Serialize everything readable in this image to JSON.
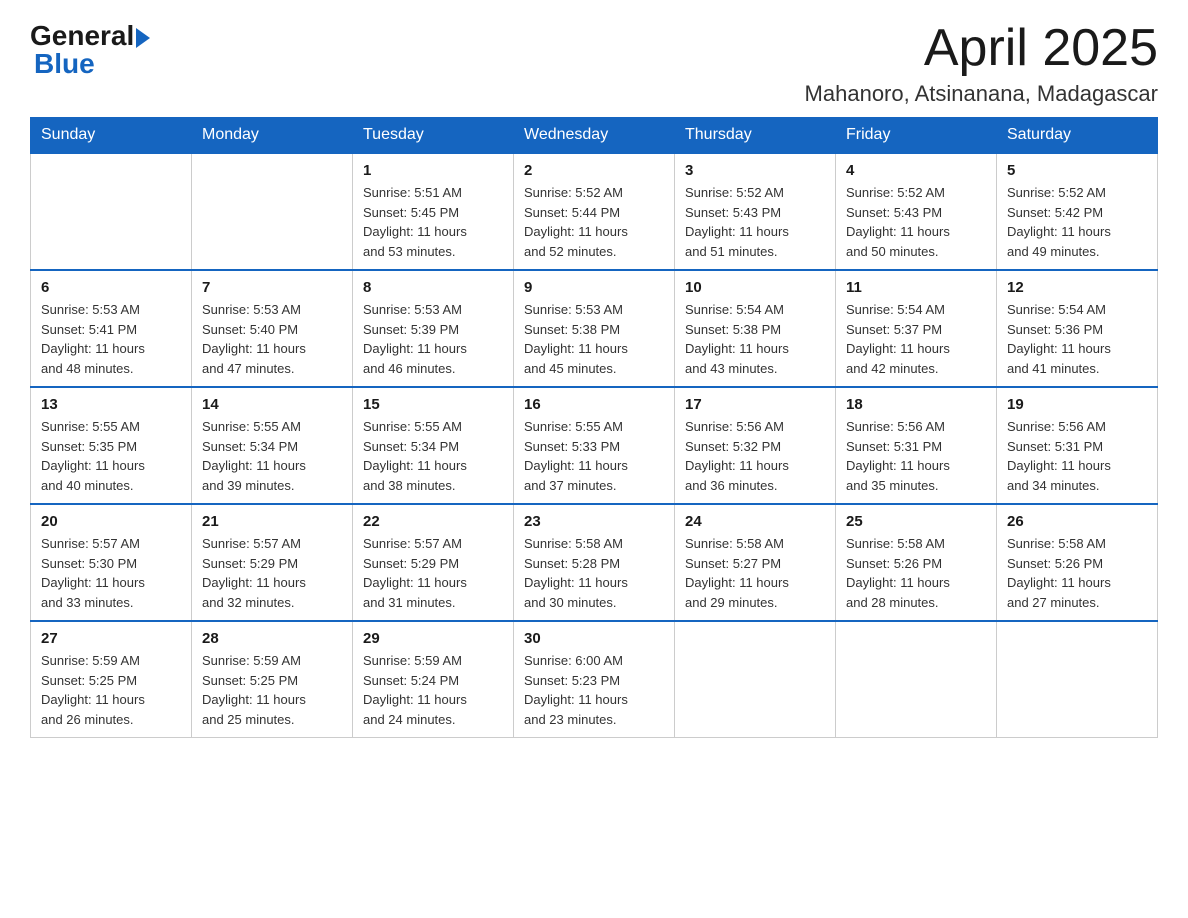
{
  "logo": {
    "general": "General",
    "blue": "Blue"
  },
  "title": "April 2025",
  "location": "Mahanoro, Atsinanana, Madagascar",
  "days_of_week": [
    "Sunday",
    "Monday",
    "Tuesday",
    "Wednesday",
    "Thursday",
    "Friday",
    "Saturday"
  ],
  "weeks": [
    [
      {
        "day": "",
        "info": ""
      },
      {
        "day": "",
        "info": ""
      },
      {
        "day": "1",
        "info": "Sunrise: 5:51 AM\nSunset: 5:45 PM\nDaylight: 11 hours\nand 53 minutes."
      },
      {
        "day": "2",
        "info": "Sunrise: 5:52 AM\nSunset: 5:44 PM\nDaylight: 11 hours\nand 52 minutes."
      },
      {
        "day": "3",
        "info": "Sunrise: 5:52 AM\nSunset: 5:43 PM\nDaylight: 11 hours\nand 51 minutes."
      },
      {
        "day": "4",
        "info": "Sunrise: 5:52 AM\nSunset: 5:43 PM\nDaylight: 11 hours\nand 50 minutes."
      },
      {
        "day": "5",
        "info": "Sunrise: 5:52 AM\nSunset: 5:42 PM\nDaylight: 11 hours\nand 49 minutes."
      }
    ],
    [
      {
        "day": "6",
        "info": "Sunrise: 5:53 AM\nSunset: 5:41 PM\nDaylight: 11 hours\nand 48 minutes."
      },
      {
        "day": "7",
        "info": "Sunrise: 5:53 AM\nSunset: 5:40 PM\nDaylight: 11 hours\nand 47 minutes."
      },
      {
        "day": "8",
        "info": "Sunrise: 5:53 AM\nSunset: 5:39 PM\nDaylight: 11 hours\nand 46 minutes."
      },
      {
        "day": "9",
        "info": "Sunrise: 5:53 AM\nSunset: 5:38 PM\nDaylight: 11 hours\nand 45 minutes."
      },
      {
        "day": "10",
        "info": "Sunrise: 5:54 AM\nSunset: 5:38 PM\nDaylight: 11 hours\nand 43 minutes."
      },
      {
        "day": "11",
        "info": "Sunrise: 5:54 AM\nSunset: 5:37 PM\nDaylight: 11 hours\nand 42 minutes."
      },
      {
        "day": "12",
        "info": "Sunrise: 5:54 AM\nSunset: 5:36 PM\nDaylight: 11 hours\nand 41 minutes."
      }
    ],
    [
      {
        "day": "13",
        "info": "Sunrise: 5:55 AM\nSunset: 5:35 PM\nDaylight: 11 hours\nand 40 minutes."
      },
      {
        "day": "14",
        "info": "Sunrise: 5:55 AM\nSunset: 5:34 PM\nDaylight: 11 hours\nand 39 minutes."
      },
      {
        "day": "15",
        "info": "Sunrise: 5:55 AM\nSunset: 5:34 PM\nDaylight: 11 hours\nand 38 minutes."
      },
      {
        "day": "16",
        "info": "Sunrise: 5:55 AM\nSunset: 5:33 PM\nDaylight: 11 hours\nand 37 minutes."
      },
      {
        "day": "17",
        "info": "Sunrise: 5:56 AM\nSunset: 5:32 PM\nDaylight: 11 hours\nand 36 minutes."
      },
      {
        "day": "18",
        "info": "Sunrise: 5:56 AM\nSunset: 5:31 PM\nDaylight: 11 hours\nand 35 minutes."
      },
      {
        "day": "19",
        "info": "Sunrise: 5:56 AM\nSunset: 5:31 PM\nDaylight: 11 hours\nand 34 minutes."
      }
    ],
    [
      {
        "day": "20",
        "info": "Sunrise: 5:57 AM\nSunset: 5:30 PM\nDaylight: 11 hours\nand 33 minutes."
      },
      {
        "day": "21",
        "info": "Sunrise: 5:57 AM\nSunset: 5:29 PM\nDaylight: 11 hours\nand 32 minutes."
      },
      {
        "day": "22",
        "info": "Sunrise: 5:57 AM\nSunset: 5:29 PM\nDaylight: 11 hours\nand 31 minutes."
      },
      {
        "day": "23",
        "info": "Sunrise: 5:58 AM\nSunset: 5:28 PM\nDaylight: 11 hours\nand 30 minutes."
      },
      {
        "day": "24",
        "info": "Sunrise: 5:58 AM\nSunset: 5:27 PM\nDaylight: 11 hours\nand 29 minutes."
      },
      {
        "day": "25",
        "info": "Sunrise: 5:58 AM\nSunset: 5:26 PM\nDaylight: 11 hours\nand 28 minutes."
      },
      {
        "day": "26",
        "info": "Sunrise: 5:58 AM\nSunset: 5:26 PM\nDaylight: 11 hours\nand 27 minutes."
      }
    ],
    [
      {
        "day": "27",
        "info": "Sunrise: 5:59 AM\nSunset: 5:25 PM\nDaylight: 11 hours\nand 26 minutes."
      },
      {
        "day": "28",
        "info": "Sunrise: 5:59 AM\nSunset: 5:25 PM\nDaylight: 11 hours\nand 25 minutes."
      },
      {
        "day": "29",
        "info": "Sunrise: 5:59 AM\nSunset: 5:24 PM\nDaylight: 11 hours\nand 24 minutes."
      },
      {
        "day": "30",
        "info": "Sunrise: 6:00 AM\nSunset: 5:23 PM\nDaylight: 11 hours\nand 23 minutes."
      },
      {
        "day": "",
        "info": ""
      },
      {
        "day": "",
        "info": ""
      },
      {
        "day": "",
        "info": ""
      }
    ]
  ]
}
